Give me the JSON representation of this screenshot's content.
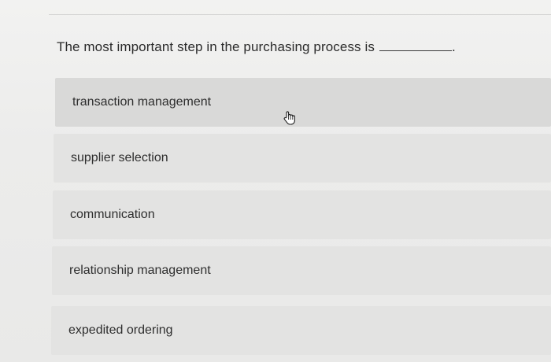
{
  "question": {
    "text": "The most important step in the purchasing process is",
    "end_punctuation": "."
  },
  "options": [
    {
      "label": "transaction management"
    },
    {
      "label": "supplier selection"
    },
    {
      "label": "communication"
    },
    {
      "label": "relationship management"
    },
    {
      "label": "expedited ordering"
    }
  ],
  "cursor": {
    "icon": "hand-pointer-icon"
  }
}
